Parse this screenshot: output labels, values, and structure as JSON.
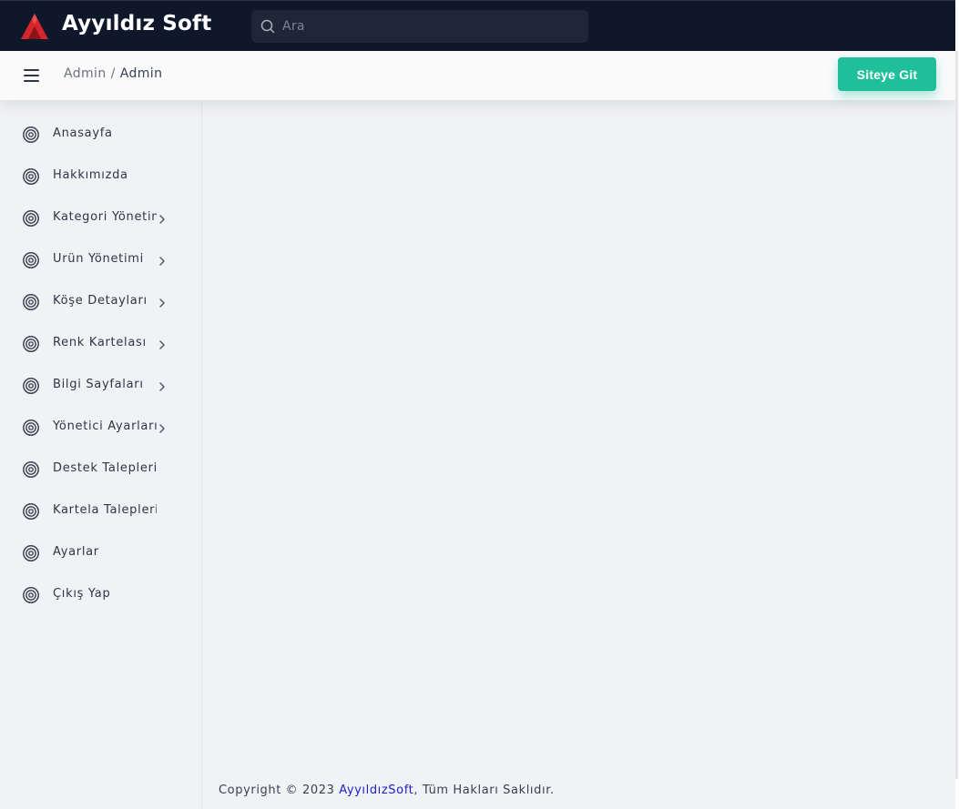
{
  "topbar": {
    "brand": "Ayyıldız Soft",
    "search_placeholder": "Ara"
  },
  "header": {
    "breadcrumb": [
      "Admin",
      "Admin"
    ],
    "breadcrumb_separator": "/",
    "site_button_label": "Siteye Git"
  },
  "sidebar": {
    "items": [
      {
        "label": "Anasayfa",
        "has_submenu": false
      },
      {
        "label": "Hakkımızda",
        "has_submenu": false
      },
      {
        "label": "Kategori Yönetimi",
        "has_submenu": true
      },
      {
        "label": "Ürün Yönetimi",
        "has_submenu": true
      },
      {
        "label": "Köşe Detayları",
        "has_submenu": true
      },
      {
        "label": "Renk Kartelası",
        "has_submenu": true
      },
      {
        "label": "Bilgi Sayfaları",
        "has_submenu": true
      },
      {
        "label": "Yönetici Ayarları",
        "has_submenu": true
      },
      {
        "label": "Destek Talepleri",
        "has_submenu": false
      },
      {
        "label": "Kartela Talepleri",
        "has_submenu": false
      },
      {
        "label": "Ayarlar",
        "has_submenu": false
      },
      {
        "label": "Çıkış Yap",
        "has_submenu": false
      }
    ]
  },
  "footer": {
    "prefix": "Copyright © 2023 ",
    "link_text": "AyyıldızSoft",
    "suffix": ", Tüm Hakları Saklıdır."
  },
  "colors": {
    "topbar_bg": "#0f172a",
    "accent_button": "#1fbf9a",
    "logo_red": "#d7262b",
    "footer_link": "#1e22c8"
  },
  "icons": {
    "logo": "brand-logo-icon",
    "search": "search-icon",
    "menu": "hamburger-menu-icon",
    "nav": "target-circle-icon",
    "submenu": "chevron-right-icon"
  }
}
